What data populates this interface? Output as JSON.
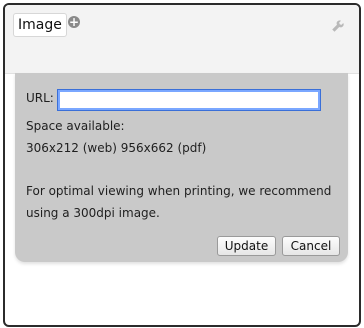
{
  "header": {
    "tab_label": "Image",
    "add_icon": "plus-circle-icon",
    "settings_icon": "wrench-icon"
  },
  "form": {
    "url_label": "URL:",
    "url_value": "",
    "space_label": "Space available:",
    "space_value": "306x212 (web) 956x662 (pdf)",
    "note_line1": "For optimal viewing when printing, we recommend",
    "note_line2": "using a 300dpi image."
  },
  "buttons": {
    "update": "Update",
    "cancel": "Cancel"
  },
  "colors": {
    "panel_bg": "#c9c9c9",
    "input_focus": "#7aa7ff"
  }
}
